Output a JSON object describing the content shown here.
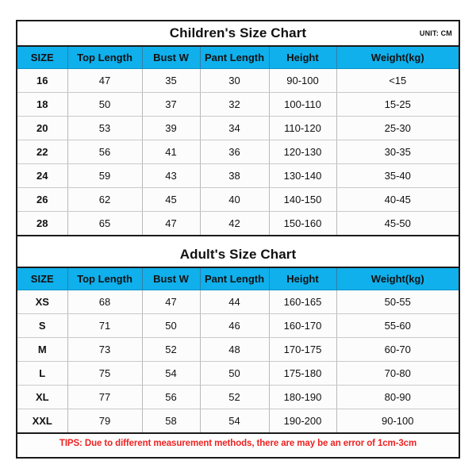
{
  "document": {
    "unit_label": "UNIT: CM",
    "accent_header_color": "#0FB0EC",
    "tips_text_color": "#EE2222",
    "border_color": "#1A1A1A"
  },
  "sections": [
    {
      "title": "Children's Size Chart",
      "unit": "UNIT: CM",
      "columns": [
        "SIZE",
        "Top Length",
        "Bust W",
        "Pant Length",
        "Height",
        "Weight(kg)"
      ],
      "rows": [
        [
          "16",
          "47",
          "35",
          "30",
          "90-100",
          "<15"
        ],
        [
          "18",
          "50",
          "37",
          "32",
          "100-110",
          "15-25"
        ],
        [
          "20",
          "53",
          "39",
          "34",
          "110-120",
          "25-30"
        ],
        [
          "22",
          "56",
          "41",
          "36",
          "120-130",
          "30-35"
        ],
        [
          "24",
          "59",
          "43",
          "38",
          "130-140",
          "35-40"
        ],
        [
          "26",
          "62",
          "45",
          "40",
          "140-150",
          "40-45"
        ],
        [
          "28",
          "65",
          "47",
          "42",
          "150-160",
          "45-50"
        ]
      ]
    },
    {
      "title": "Adult's Size Chart",
      "unit": "",
      "columns": [
        "SIZE",
        "Top Length",
        "Bust W",
        "Pant Length",
        "Height",
        "Weight(kg)"
      ],
      "rows": [
        [
          "XS",
          "68",
          "47",
          "44",
          "160-165",
          "50-55"
        ],
        [
          "S",
          "71",
          "50",
          "46",
          "160-170",
          "55-60"
        ],
        [
          "M",
          "73",
          "52",
          "48",
          "170-175",
          "60-70"
        ],
        [
          "L",
          "75",
          "54",
          "50",
          "175-180",
          "70-80"
        ],
        [
          "XL",
          "77",
          "56",
          "52",
          "180-190",
          "80-90"
        ],
        [
          "XXL",
          "79",
          "58",
          "54",
          "190-200",
          "90-100"
        ]
      ]
    }
  ],
  "footer": {
    "tips": "TIPS: Due to different measurement methods, there are may be an error of 1cm-3cm"
  }
}
